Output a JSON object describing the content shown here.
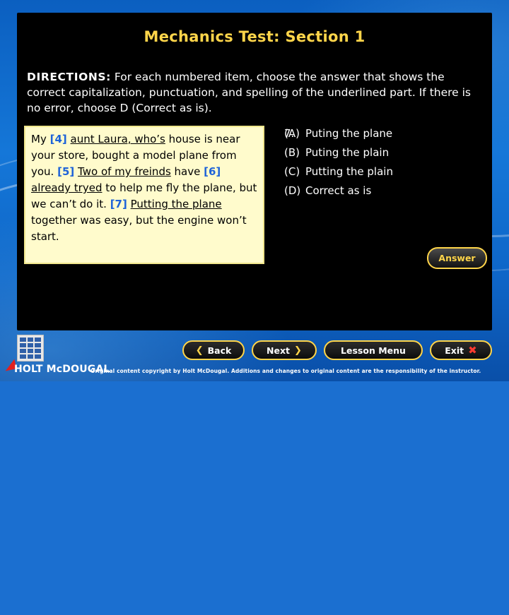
{
  "slide": {
    "title": "Mechanics Test: Section 1",
    "directions": {
      "lead": "DIRECTIONS:",
      "text": " For each numbered item, choose the answer that shows the correct capitalization, punctuation, and spelling of the underlined part. If there is no error, choose D (Correct as is)."
    },
    "passage": {
      "segments": [
        {
          "t": " My ",
          "style": "plain"
        },
        {
          "t": "[4]",
          "style": "num"
        },
        {
          "t": " ",
          "style": "plain"
        },
        {
          "t": "aunt Laura, who’s",
          "style": "underline"
        },
        {
          "t": " house is near your store, bought a model plane from you. ",
          "style": "plain"
        },
        {
          "t": "[5]",
          "style": "num"
        },
        {
          "t": " ",
          "style": "plain"
        },
        {
          "t": "Two of my freinds",
          "style": "underline"
        },
        {
          "t": " have ",
          "style": "plain"
        },
        {
          "t": "[6]",
          "style": "num"
        },
        {
          "t": " ",
          "style": "plain"
        },
        {
          "t": "already tryed",
          "style": "underline"
        },
        {
          "t": " to help me fly the plane, but we can’t do it. ",
          "style": "plain"
        },
        {
          "t": "[7]",
          "style": "num"
        },
        {
          "t": " ",
          "style": "plain"
        },
        {
          "t": "Putting the plane",
          "style": "underline"
        },
        {
          "t": " together was easy, but the engine won’t start.",
          "style": "plain"
        }
      ]
    },
    "question": {
      "number": "7.",
      "choices": [
        {
          "label": "(A)",
          "text": "Puting the plane"
        },
        {
          "label": "(B)",
          "text": "Puting the plain"
        },
        {
          "label": "(C)",
          "text": "Putting the plain"
        },
        {
          "label": "(D)",
          "text": "Correct as is"
        }
      ]
    },
    "answer_button": "Answer",
    "nav": {
      "back": "Back",
      "next": "Next",
      "lesson_menu": "Lesson Menu",
      "exit": "Exit"
    },
    "footer": {
      "logo_text": "HOLT McDOUGAL",
      "copyright": "Original content copyright by Holt McDougal. Additions and changes to original content are the responsibility of the instructor."
    },
    "colors": {
      "title": "#ffd54a",
      "accent": "#ffd54a",
      "passage_bg": "#fffbcc",
      "bracket_number": "#1e63d8",
      "background": "#1577d8"
    }
  }
}
